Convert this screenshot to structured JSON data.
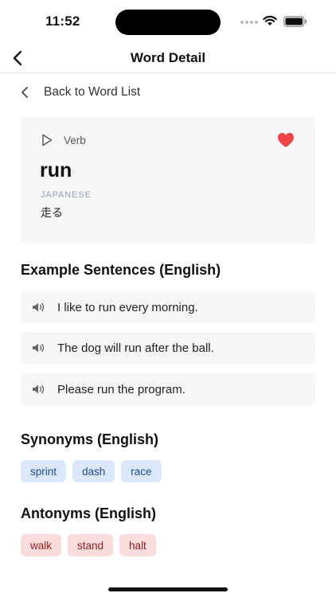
{
  "status_bar": {
    "time": "11:52"
  },
  "nav": {
    "title": "Word Detail"
  },
  "back_link": {
    "label": "Back to Word List"
  },
  "word_card": {
    "part_of_speech": "Verb",
    "word": "run",
    "language_label": "JAPANESE",
    "translation": "走る",
    "favorite": true
  },
  "examples": {
    "title": "Example Sentences (English)",
    "items": [
      "I like to run every morning.",
      "The dog will run after the ball.",
      "Please run the program."
    ]
  },
  "synonyms": {
    "title": "Synonyms (English)",
    "items": [
      "sprint",
      "dash",
      "race"
    ]
  },
  "antonyms": {
    "title": "Antonyms (English)",
    "items": [
      "walk",
      "stand",
      "halt"
    ]
  },
  "colors": {
    "favorite": "#ef4444",
    "synonym_chip_bg": "#dbe8fb",
    "antonym_chip_bg": "#fadcdc"
  },
  "icons": {
    "nav_back": "chevron-left-icon",
    "back_link": "chevron-left-icon",
    "play": "play-icon",
    "favorite": "heart-icon",
    "speaker": "speaker-icon"
  }
}
